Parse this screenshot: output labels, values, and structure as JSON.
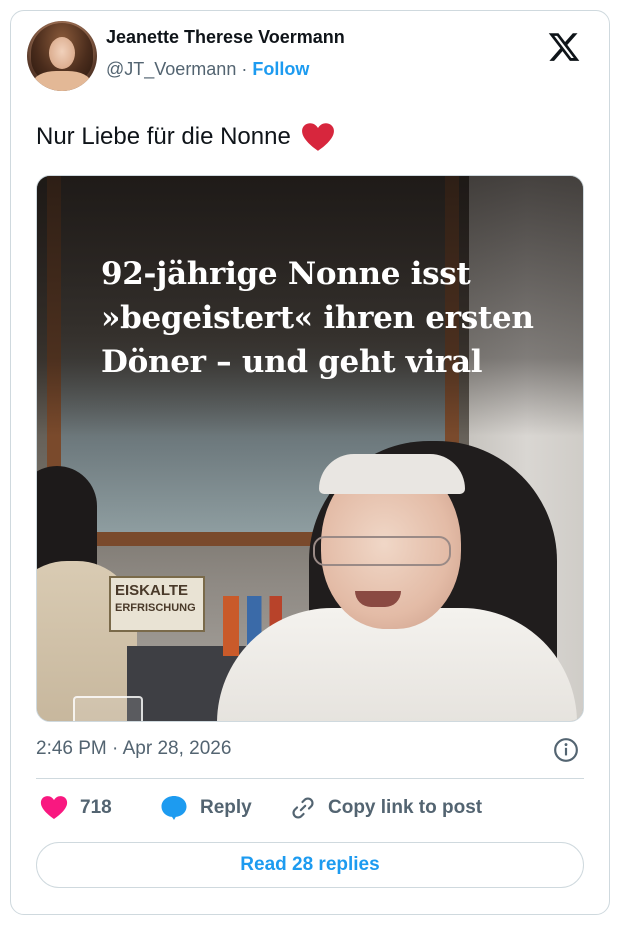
{
  "author": {
    "display_name": "Jeanette Therese Voermann",
    "handle": "@JT_Voermann",
    "separator": "·",
    "follow_label": "Follow"
  },
  "platform_icon": "x-logo-icon",
  "tweet": {
    "text": "Nur Liebe für die Nonne",
    "emoji": "red-heart-emoji"
  },
  "media": {
    "headline_lines": [
      "92-jährige Nonne isst",
      "»begeistert« ihren ersten",
      "Döner – und geht viral"
    ],
    "sign_line1": "EISKALTE",
    "sign_line2": "ERFRISCHUNG"
  },
  "meta": {
    "time": "2:46 PM",
    "separator": "·",
    "date": "Apr 28, 2026",
    "info_icon": "info-icon"
  },
  "actions": {
    "like_count": "718",
    "reply_label": "Reply",
    "copy_label": "Copy link to post"
  },
  "read_replies_label": "Read 28 replies",
  "colors": {
    "accent": "#1d9bf0",
    "like": "#f91880",
    "heart_emoji": "#d7263d",
    "muted": "#536471",
    "border": "#cfd9de"
  }
}
